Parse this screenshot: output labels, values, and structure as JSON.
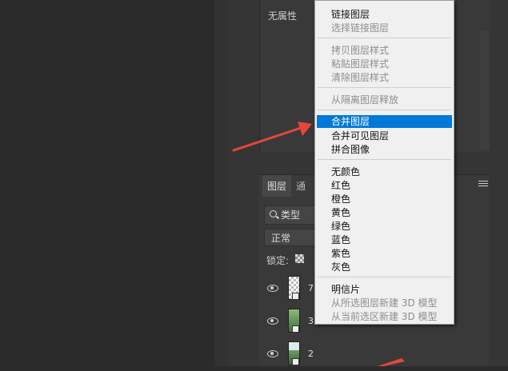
{
  "properties": {
    "no_properties": "无属性"
  },
  "layers_panel": {
    "tab_layers": "图层",
    "tab_channels": "通",
    "filter_label": "类型",
    "blend_mode": "正常",
    "lock_label": "锁定:",
    "layers": [
      {
        "name": "7",
        "thumb": "transparent"
      },
      {
        "name": "3",
        "thumb": "photo"
      },
      {
        "name": "2",
        "thumb": "photo2"
      }
    ]
  },
  "context_menu": {
    "items": [
      {
        "label": "链接图层",
        "enabled": true
      },
      {
        "label": "选择链接图层",
        "enabled": false
      },
      {
        "label": "拷贝图层样式",
        "enabled": false
      },
      {
        "label": "粘贴图层样式",
        "enabled": false
      },
      {
        "label": "清除图层样式",
        "enabled": false
      },
      {
        "label": "从隔离图层释放",
        "enabled": false
      },
      {
        "label": "合并图层",
        "enabled": true,
        "highlighted": true
      },
      {
        "label": "合并可见图层",
        "enabled": true
      },
      {
        "label": "拼合图像",
        "enabled": true
      },
      {
        "label": "无颜色",
        "enabled": true
      },
      {
        "label": "红色",
        "enabled": true
      },
      {
        "label": "橙色",
        "enabled": true
      },
      {
        "label": "黄色",
        "enabled": true
      },
      {
        "label": "绿色",
        "enabled": true
      },
      {
        "label": "蓝色",
        "enabled": true
      },
      {
        "label": "紫色",
        "enabled": true
      },
      {
        "label": "灰色",
        "enabled": true
      },
      {
        "label": "明信片",
        "enabled": true
      },
      {
        "label": "从所选图层新建 3D 模型",
        "enabled": false
      },
      {
        "label": "从当前选区新建 3D 模型",
        "enabled": false
      }
    ]
  },
  "colors": {
    "highlight": "#0078d7",
    "annotation_arrow": "#e8463c",
    "panel_bg": "#393939"
  }
}
